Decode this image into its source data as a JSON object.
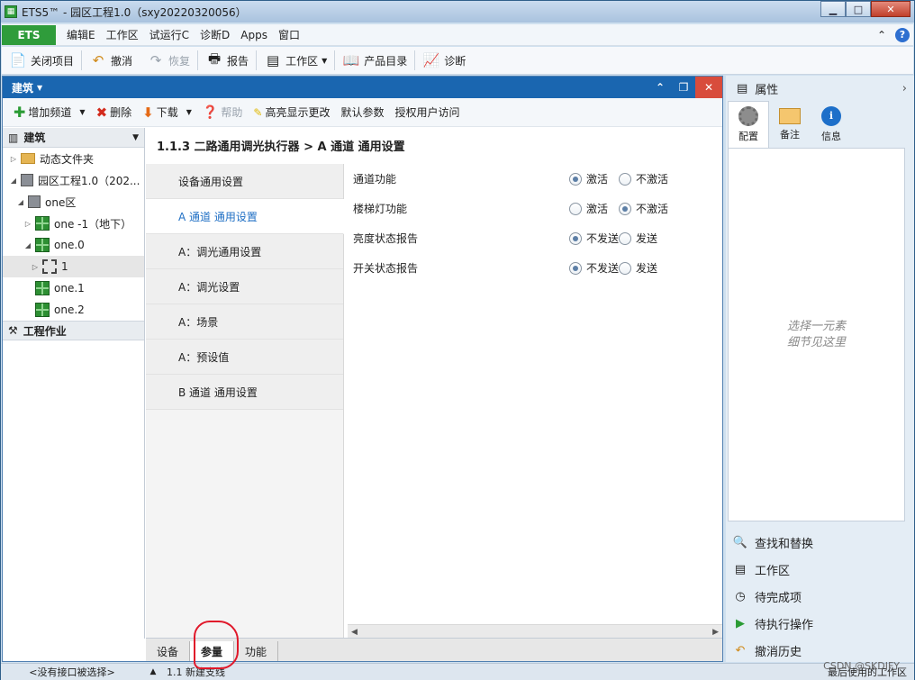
{
  "window": {
    "title": "ETS5™ - 园区工程1.0（sxy20220320056）",
    "app_icon": "ets-app-icon"
  },
  "menubar": {
    "ets_label": "ETS",
    "items": [
      "编辑E",
      "工作区",
      "试运行C",
      "诊断D",
      "Apps",
      "窗口"
    ],
    "help_label": "?"
  },
  "toolbar": {
    "close_project": "关闭项目",
    "undo": "撤消",
    "redo": "恢复",
    "report": "报告",
    "workspace": "工作区",
    "catalog": "产品目录",
    "diagnostics": "诊断"
  },
  "panel": {
    "title": "建筑",
    "add_channel": "增加频道",
    "delete": "删除",
    "download": "下载",
    "help": "帮助",
    "highlight": "高亮显示更改",
    "default_params": "默认参数",
    "authorize": "授权用户访问"
  },
  "tree": {
    "header": "建筑",
    "items": [
      {
        "label": "动态文件夹"
      },
      {
        "label": "园区工程1.0（202..."
      },
      {
        "label": "one区"
      },
      {
        "label": "one -1（地下）"
      },
      {
        "label": "one.0"
      },
      {
        "label": "1"
      },
      {
        "label": "one.1"
      },
      {
        "label": "one.2"
      }
    ],
    "footer": "工程作业"
  },
  "center": {
    "breadcrumb": "1.1.3 二路通用调光执行器 > A 通道 通用设置",
    "sections": [
      "设备通用设置",
      "A 通道 通用设置",
      "A：调光通用设置",
      "A：调光设置",
      "A：场景",
      "A：预设值",
      "B 通道 通用设置"
    ],
    "params": [
      {
        "label": "通道功能",
        "opt1": "激活",
        "opt2": "不激活",
        "selected": 1
      },
      {
        "label": "楼梯灯功能",
        "opt1": "激活",
        "opt2": "不激活",
        "selected": 2
      },
      {
        "label": "亮度状态报告",
        "opt1": "不发送",
        "opt2": "发送",
        "selected": 1
      },
      {
        "label": "开关状态报告",
        "opt1": "不发送",
        "opt2": "发送",
        "selected": 1
      }
    ],
    "bottom_tabs": [
      "设备",
      "参量",
      "功能"
    ]
  },
  "right_panel": {
    "title": "属性",
    "tabs": [
      "配置",
      "备注",
      "信息"
    ],
    "placeholder_line1": "选择一元素",
    "placeholder_line2": "细节见这里",
    "links": [
      "查找和替换",
      "工作区",
      "待完成项",
      "待执行操作",
      "撤消历史"
    ]
  },
  "statusbar": {
    "interface": "<没有接口被选择>",
    "line": "1.1 新建支线",
    "last_workspace": "最后使用的工作区"
  },
  "watermark": "CSDN @SKDJFY",
  "colors": {
    "ets_green": "#2f9c3b",
    "panel_blue": "#1a66b0",
    "active_blue": "#1f6fc4",
    "annotation_red": "#e0182a"
  }
}
